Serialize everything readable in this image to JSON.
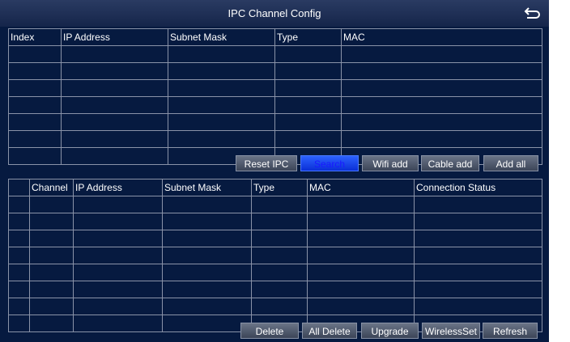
{
  "window": {
    "title": "IPC Channel Config",
    "back_icon": "return-arrow-icon"
  },
  "search_table": {
    "headers": [
      "Index",
      "IP Address",
      "Subnet Mask",
      "Type",
      "MAC"
    ],
    "rows": []
  },
  "search_buttons": {
    "reset_ipc": "Reset IPC",
    "search": "Search",
    "wifi_add": "Wifi add",
    "cable_add": "Cable add",
    "add_all": "Add all"
  },
  "channel_table": {
    "headers": [
      "",
      "Channel",
      "IP Address",
      "Subnet Mask",
      "Type",
      "MAC",
      "Connection Status"
    ],
    "rows": []
  },
  "channel_buttons": {
    "delete": "Delete",
    "all_delete": "All Delete",
    "upgrade": "Upgrade",
    "wireless_set": "WirelessSet",
    "refresh": "Refresh"
  },
  "colors": {
    "background": "#061a40",
    "title_bar": "#1c2c52",
    "active_button": "#1e4cff"
  }
}
